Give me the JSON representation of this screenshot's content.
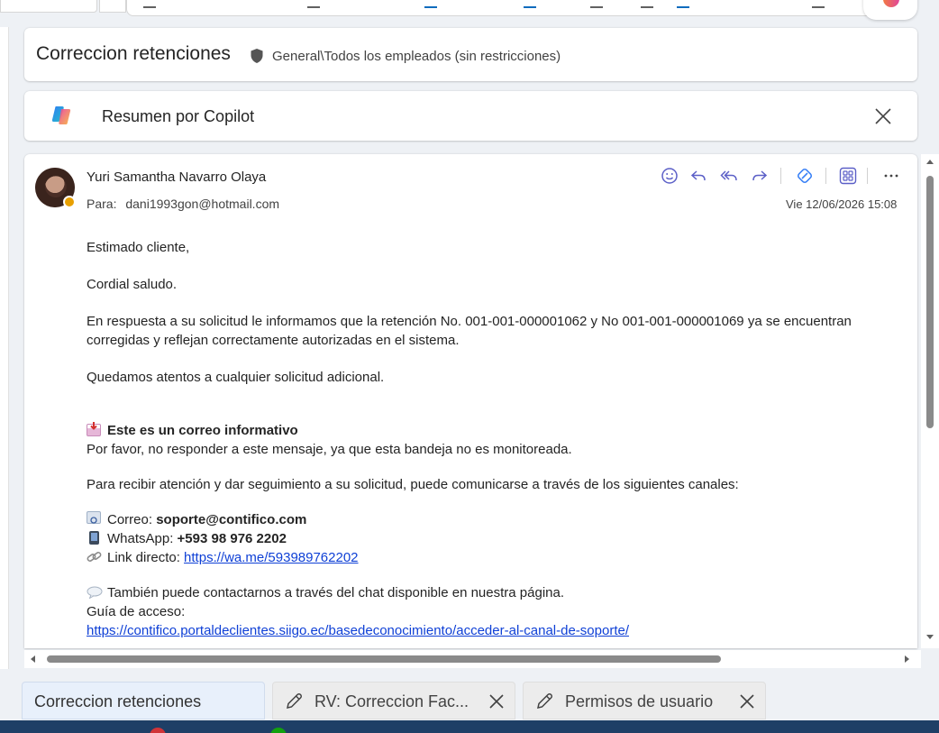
{
  "subject": {
    "title": "Correccion retenciones",
    "sensitivity_label": "General\\Todos los empleados (sin restricciones)"
  },
  "copilot": {
    "label": "Resumen por Copilot"
  },
  "message": {
    "sender_name": "Yuri Samantha Navarro Olaya",
    "to_label": "Para:",
    "to_address": "dani1993gon@hotmail.com",
    "date": "Vie 12/06/2026 15:08",
    "body": {
      "greeting": "Estimado cliente,",
      "salutation": "Cordial saludo.",
      "paragraph_1": "En respuesta a su solicitud le informamos que la retención No. 001-001-000001062 y No 001-001-000001069 ya se encuentran corregidas y reflejan correctamente autorizadas en el sistema.",
      "paragraph_2": "Quedamos atentos a cualquier solicitud adicional.",
      "notice_title": "Este es un correo informativo",
      "notice_text": "Por favor, no responder a este mensaje, ya que esta bandeja no es monitoreada.",
      "channels_intro": "Para recibir atención y dar seguimiento a su solicitud, puede comunicarse a través de los siguientes canales:",
      "email_label": "Correo: ",
      "email_value": "soporte@contifico.com",
      "whatsapp_label": "WhatsApp: ",
      "whatsapp_value": "+593 98 976 2202",
      "link_label": "Link directo: ",
      "link_value": "https://wa.me/593989762202",
      "chat_text": "También puede contactarnos a través del chat disponible en nuestra página.",
      "guide_label": "Guía de acceso:",
      "guide_link": "https://contifico.portaldeclientes.siigo.ec/basedeconocimiento/acceder-al-canal-de-soporte/"
    }
  },
  "tabs": [
    {
      "label": "Correccion retenciones",
      "active": true
    },
    {
      "label": "RV: Correccion Fac...",
      "active": false
    },
    {
      "label": "Permisos de usuario",
      "active": false
    }
  ],
  "icons": {
    "sensitivity": "shield-icon",
    "copilot": "copilot-logo-icon",
    "close": "close-icon",
    "actions": [
      "emoji-icon",
      "reply-icon",
      "reply-all-icon",
      "forward-icon",
      "loop-icon",
      "apps-icon",
      "more-icon"
    ]
  },
  "colors": {
    "accent": "#5b5fc7",
    "link": "#0f40d6",
    "presence": "#e8a000",
    "active_tab": "#e8f0fb"
  }
}
